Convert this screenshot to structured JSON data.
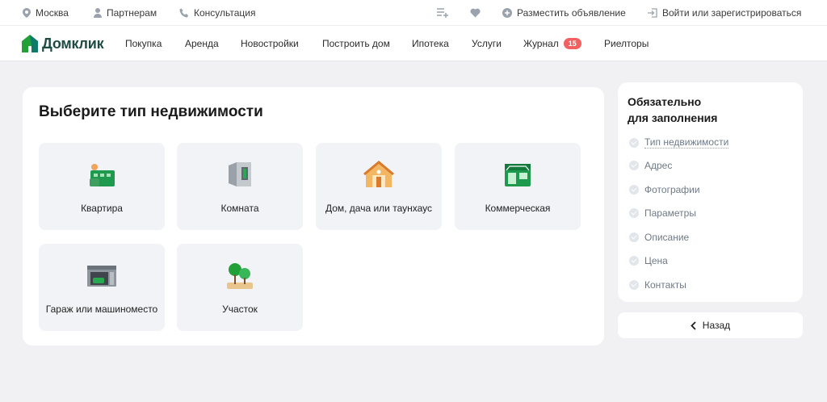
{
  "topbar": {
    "city": "Москва",
    "partners": "Партнерам",
    "consultation": "Консультация",
    "post_ad": "Разместить объявление",
    "login": "Войти или зарегистрироваться"
  },
  "brand": {
    "name": "Домклик",
    "color": "#21a038"
  },
  "nav": {
    "items": [
      "Покупка",
      "Аренда",
      "Новостройки",
      "Построить дом",
      "Ипотека",
      "Услуги",
      "Журнал",
      "Риелторы"
    ],
    "journal_badge": "15"
  },
  "main": {
    "title": "Выберите тип недвижимости",
    "tiles": [
      {
        "label": "Квартира",
        "icon": "apartment-icon"
      },
      {
        "label": "Комната",
        "icon": "room-icon"
      },
      {
        "label": "Дом, дача или таунхаус",
        "icon": "house-icon"
      },
      {
        "label": "Коммерческая",
        "icon": "commercial-icon"
      },
      {
        "label": "Гараж или машиноместо",
        "icon": "garage-icon"
      },
      {
        "label": "Участок",
        "icon": "land-plot-icon"
      }
    ]
  },
  "sidebar": {
    "title_line1": "Обязательно",
    "title_line2": "для заполнения",
    "items": [
      "Тип недвижимости",
      "Адрес",
      "Фотографии",
      "Параметры",
      "Описание",
      "Цена",
      "Контакты"
    ]
  },
  "back_label": "Назад"
}
